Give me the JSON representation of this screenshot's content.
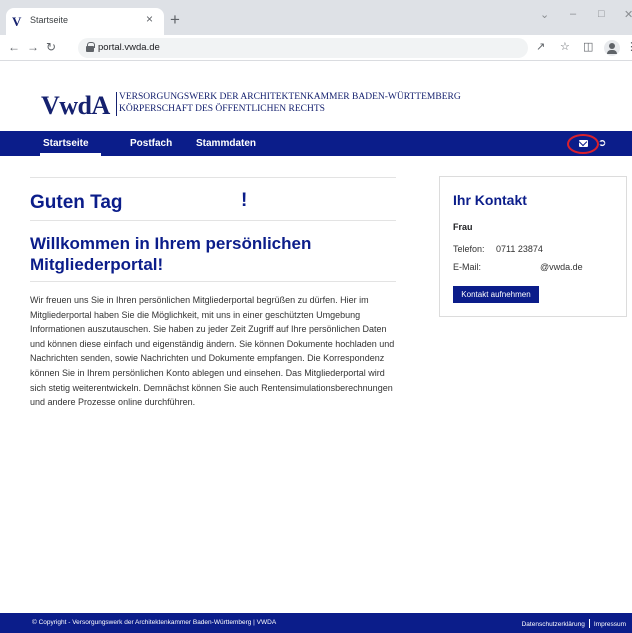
{
  "browser": {
    "tab_title": "Startseite",
    "tab_favicon": "V",
    "tab_close": "×",
    "new_tab": "+",
    "url": "portal.vwda.de",
    "icons": [
      "back-arrow-icon",
      "forward-arrow-icon",
      "reload-icon",
      "lock-icon",
      "share-icon",
      "star-icon",
      "sidepanel-icon",
      "profile-icon",
      "menu-icon"
    ]
  },
  "header": {
    "logo_mark": "VwdA",
    "logo_line1": "VERSORGUNGSWERK DER ARCHITEKTENKAMMER BADEN-WÜRTTEMBERG",
    "logo_line2": "KÖRPERSCHAFT DES ÖFFENTLICHEN RECHTS"
  },
  "nav": {
    "items": [
      {
        "label": "Startseite",
        "active": true
      },
      {
        "label": "Postfach",
        "active": false
      },
      {
        "label": "Stammdaten",
        "active": false
      }
    ],
    "mail_icon": "envelope-icon",
    "logout_icon": "logout-icon",
    "highlight_color": "#d9202c"
  },
  "main": {
    "greeting": "Guten Tag",
    "greeting_end": "!",
    "welcome": "Willkommen in Ihrem persönlichen Mitgliederportal!",
    "intro": "Wir freuen uns Sie in Ihren persönlichen Mitgliederportal begrüßen zu dürfen. Hier im Mitgliederportal haben Sie die Möglichkeit, mit uns in einer geschützten Umgebung Informationen auszutauschen. Sie haben zu jeder Zeit Zugriff auf Ihre persönlichen Daten und können diese einfach und eigenständig ändern. Sie können Dokumente hochladen und Nachrichten senden, sowie Nachrichten und Dokumente empfangen. Die Korrespondenz können Sie in Ihrem persönlichen Konto ablegen und einsehen. Das Mitgliederportal wird sich stetig weiterentwickeln. Demnächst können Sie auch Rentensimulationsberechnungen und andere Prozesse online durchführen."
  },
  "contact": {
    "title": "Ihr Kontakt",
    "name": "Frau",
    "phone_label": "Telefon:",
    "phone_value": "0711 23874",
    "email_label": "E-Mail:",
    "email_value": "@vwda.de",
    "button": "Kontakt aufnehmen"
  },
  "footer": {
    "copyright": "© Copyright - Versorgungswerk der Architektenkammer Baden-Württemberg | VWDA",
    "privacy": "Datenschutzerklärung",
    "imprint": "Impressum"
  },
  "colors": {
    "brand_blue": "#0b1d8a",
    "logo_blue": "#15216f"
  }
}
